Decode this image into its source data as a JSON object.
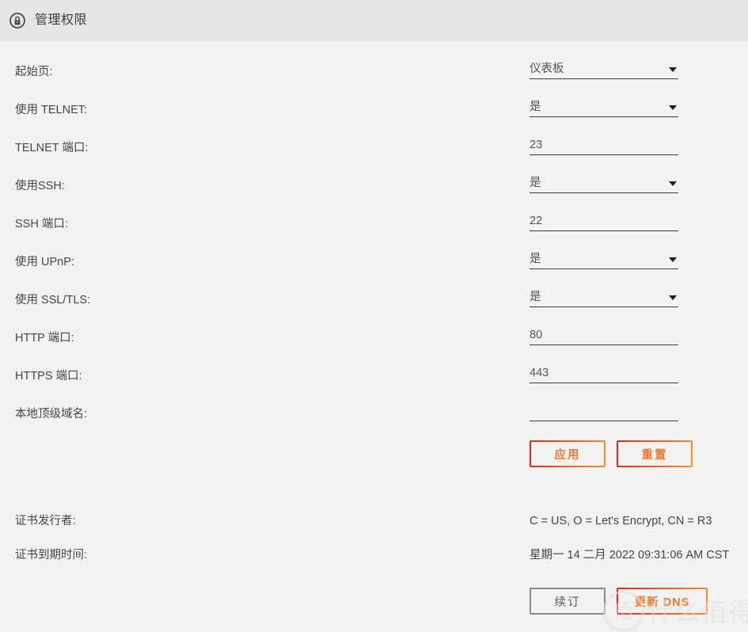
{
  "titlebar": {
    "icon": "lock-circle-icon",
    "title": "管理权限"
  },
  "form": {
    "rows": [
      {
        "label": "起始页:",
        "type": "select",
        "value": "仪表板",
        "name": "start-page"
      },
      {
        "label": "使用 TELNET:",
        "type": "select",
        "value": "是",
        "name": "use-telnet"
      },
      {
        "label": "TELNET 端口:",
        "type": "input",
        "value": "23",
        "name": "telnet-port"
      },
      {
        "label": "使用SSH:",
        "type": "select",
        "value": "是",
        "name": "use-ssh"
      },
      {
        "label": "SSH 端口:",
        "type": "input",
        "value": "22",
        "name": "ssh-port"
      },
      {
        "label": "使用 UPnP:",
        "type": "select",
        "value": "是",
        "name": "use-upnp"
      },
      {
        "label": "使用 SSL/TLS:",
        "type": "select",
        "value": "是",
        "name": "use-ssl-tls"
      },
      {
        "label": "HTTP 端口:",
        "type": "input",
        "value": "80",
        "name": "http-port"
      },
      {
        "label": "HTTPS 端口:",
        "type": "input",
        "value": "443",
        "name": "https-port"
      },
      {
        "label": "本地顶级域名:",
        "type": "input",
        "value": "",
        "name": "local-tld"
      }
    ]
  },
  "actions": {
    "apply_label": "应用",
    "reset_label": "重置"
  },
  "certificate": {
    "issuer_label": "证书发行者:",
    "issuer_value": "C = US, O = Let's Encrypt, CN = R3",
    "expiry_label": "证书到期时间:",
    "expiry_value": "星期一 14 二月 2022 09:31:06 AM CST",
    "renew_label": "续订",
    "update_dns_label": "更新 DNS"
  },
  "watermark": {
    "badge": "值",
    "text": "什么值得买"
  },
  "colors": {
    "page_bg": "#f2f2f2",
    "titlebar_bg": "#e5e5e5",
    "accent_start": "#e8231e",
    "accent_end": "#f79121",
    "accent_text": "#f07a2a",
    "label_text": "#454545",
    "field_underline": "#3a3a3a"
  }
}
